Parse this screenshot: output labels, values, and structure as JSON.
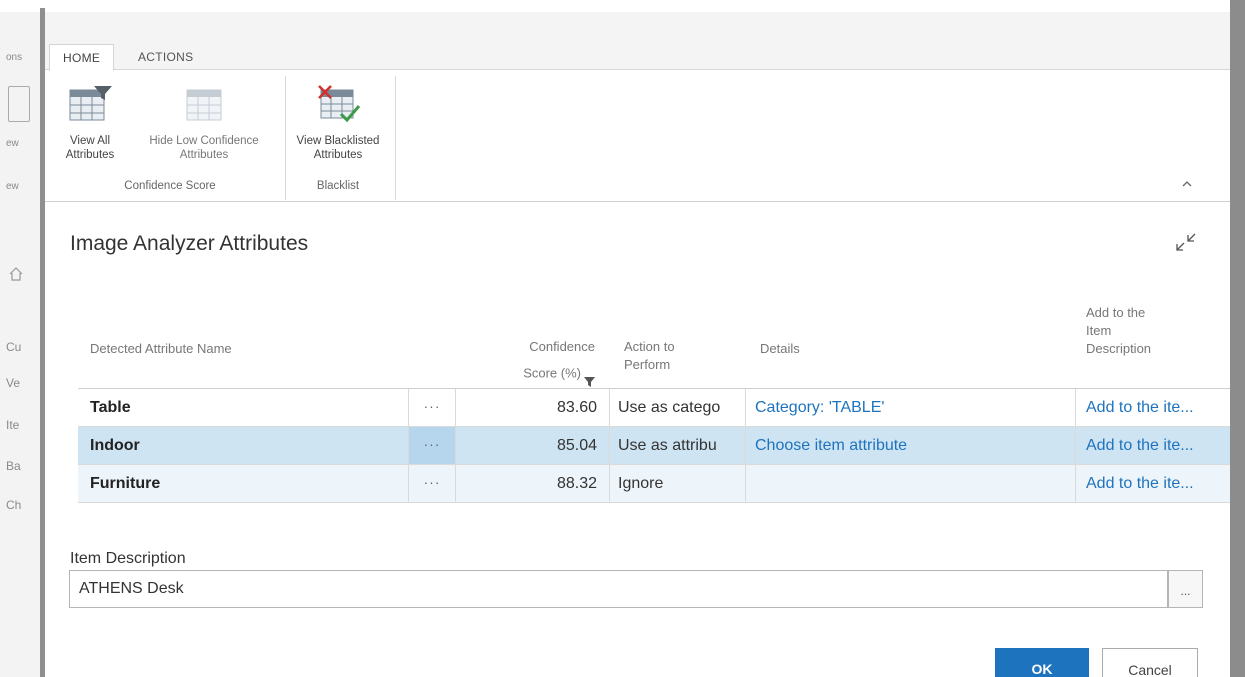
{
  "background": {
    "fragments": [
      "ons",
      "ew",
      "ew",
      "Cu",
      "Ve",
      "Ite",
      "Ba",
      "Ch"
    ]
  },
  "ribbon": {
    "tabs": [
      "HOME",
      "ACTIONS"
    ],
    "buttons": {
      "view_all": "View All\nAttributes",
      "hide_low": "Hide Low Confidence\nAttributes",
      "view_blacklisted": "View Blacklisted\nAttributes"
    },
    "groups": [
      "Confidence Score",
      "Blacklist"
    ],
    "collapse_icon": "chevron-up-icon"
  },
  "dialog": {
    "title": "Image Analyzer Attributes",
    "shrink_icon": "collapse-arrows-icon"
  },
  "table": {
    "headers": {
      "name": "Detected Attribute Name",
      "score": "Confidence\nScore (%)",
      "action": "Action to\nPerform",
      "details": "Details",
      "add": "Add to the\nItem\nDescription"
    },
    "rows": [
      {
        "name": "Table",
        "dots": "···",
        "score": "83.60",
        "action": "Use as catego",
        "details": "Category: 'TABLE'",
        "add": "Add to the ite..."
      },
      {
        "name": "Indoor",
        "dots": "···",
        "score": "85.04",
        "action": "Use as attribu",
        "details": "Choose item attribute",
        "add": "Add to the ite..."
      },
      {
        "name": "Furniture",
        "dots": "···",
        "score": "88.32",
        "action": "Ignore",
        "details": "",
        "add": "Add to the ite..."
      }
    ],
    "selected_row": 1
  },
  "item_description": {
    "label": "Item Description",
    "value": "ATHENS Desk",
    "lookup": "..."
  },
  "footer": {
    "ok": "OK",
    "cancel": "Cancel"
  },
  "colors": {
    "accent": "#1e73be",
    "selected_row": "#cfe4f3"
  }
}
